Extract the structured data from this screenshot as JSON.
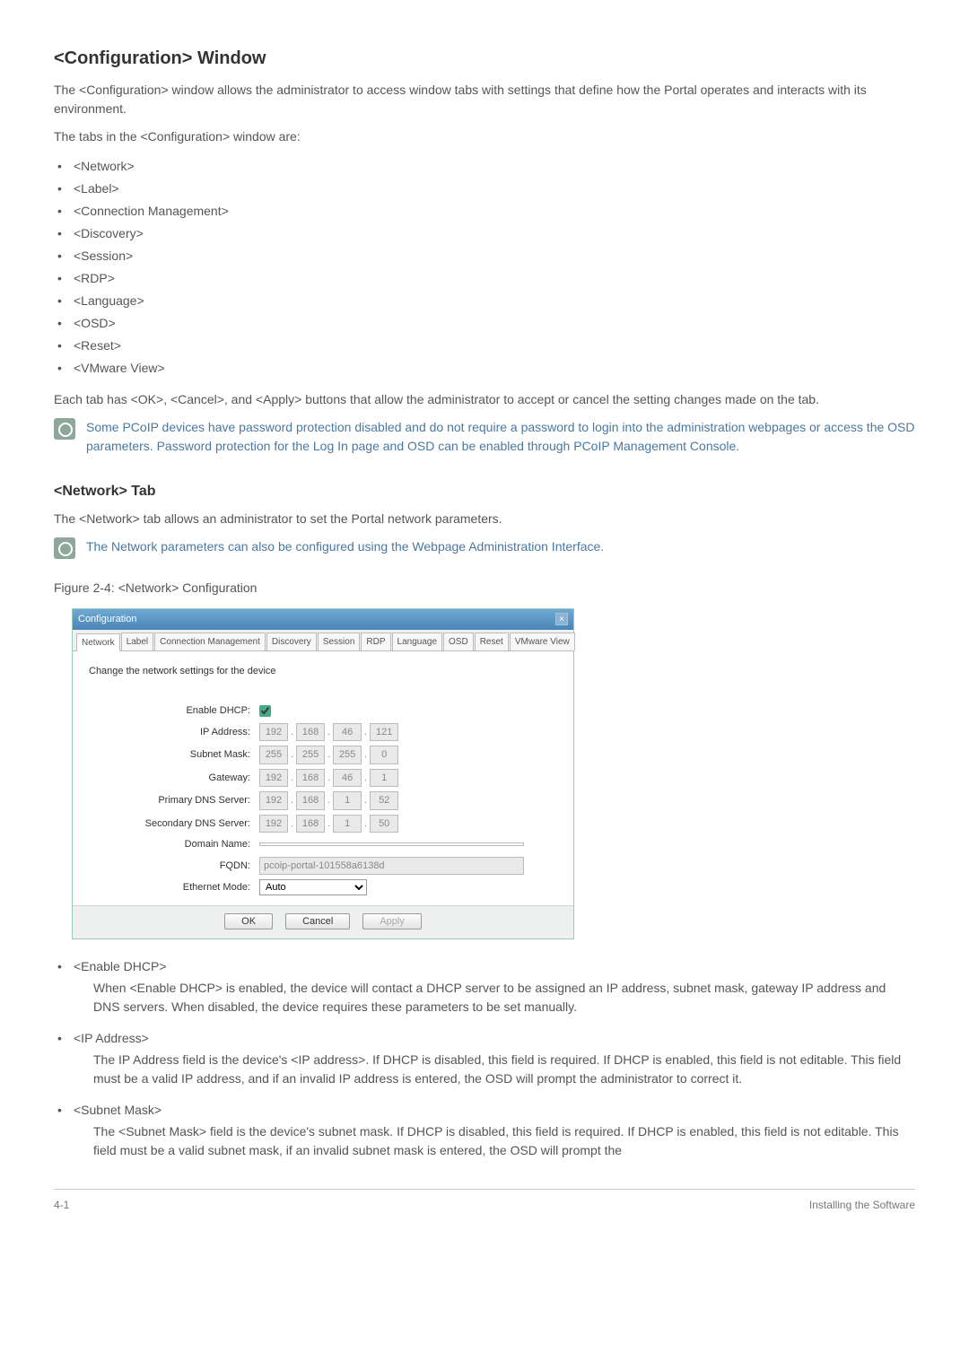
{
  "heading": "<Configuration> Window",
  "intro1": "The <Configuration> window allows the administrator to access window tabs with settings that define how the Portal operates and interacts with its environment.",
  "intro2": "The tabs in the <Configuration> window are:",
  "tab_list": [
    "<Network>",
    "<Label>",
    "<Connection Management>",
    "<Discovery>",
    "<Session>",
    "<RDP>",
    "<Language>",
    "<OSD>",
    "<Reset>",
    "<VMware View>"
  ],
  "after_tabs": "Each tab has <OK>, <Cancel>, and <Apply> buttons that allow the administrator to accept or cancel the setting changes made on the tab.",
  "note1": "Some PCoIP devices have password protection disabled and do not require a password to login into the administration webpages or access the OSD parameters.  Password protection for the Log In page and OSD can be enabled through PCoIP Management Console.",
  "sub_heading": "<Network> Tab",
  "sub_intro": "The <Network> tab allows an administrator to set the Portal network parameters.",
  "note2": "The Network parameters can also be configured using the Webpage Administration Interface.",
  "figure_caption_prefix": "Figure 2-4",
  "figure_caption_text": ": <Network> Configuration",
  "config_window": {
    "title": "Configuration",
    "tabs": [
      "Network",
      "Label",
      "Connection Management",
      "Discovery",
      "Session",
      "RDP",
      "Language",
      "OSD",
      "Reset",
      "VMware View"
    ],
    "prompt": "Change the network settings for the device",
    "fields": {
      "enable_dhcp_label": "Enable DHCP:",
      "ip_address_label": "IP Address:",
      "ip_address": [
        "192",
        "168",
        "46",
        "121"
      ],
      "subnet_mask_label": "Subnet Mask:",
      "subnet_mask": [
        "255",
        "255",
        "255",
        "0"
      ],
      "gateway_label": "Gateway:",
      "gateway": [
        "192",
        "168",
        "46",
        "1"
      ],
      "primary_dns_label": "Primary DNS Server:",
      "primary_dns": [
        "192",
        "168",
        "1",
        "52"
      ],
      "secondary_dns_label": "Secondary DNS Server:",
      "secondary_dns": [
        "192",
        "168",
        "1",
        "50"
      ],
      "domain_name_label": "Domain Name:",
      "domain_name": "",
      "fqdn_label": "FQDN:",
      "fqdn": "pcoip-portal-101558a6138d",
      "ethernet_mode_label": "Ethernet Mode:",
      "ethernet_mode": "Auto"
    },
    "buttons": {
      "ok": "OK",
      "cancel": "Cancel",
      "apply": "Apply"
    }
  },
  "desc": [
    {
      "term": "<Enable DHCP>",
      "text": "When <Enable DHCP> is enabled, the device will contact a DHCP server to be assigned an IP address, subnet mask, gateway IP address and DNS servers. When disabled, the device requires these parameters to be set manually."
    },
    {
      "term": "<IP Address>",
      "text": "The IP Address field is the device's <IP address>. If DHCP is disabled, this field is required. If DHCP is enabled, this field is not editable. This field must be a valid IP address, and if an invalid IP address is entered, the OSD will prompt the administrator to correct it."
    },
    {
      "term": "<Subnet Mask>",
      "text": "The <Subnet Mask> field is the device's subnet mask. If DHCP is disabled, this field is required. If DHCP is enabled, this field is not editable. This field must be a valid subnet mask, if an invalid subnet mask is entered, the OSD will prompt the"
    }
  ],
  "footer": {
    "left": "4-1",
    "right": "Installing the Software"
  }
}
